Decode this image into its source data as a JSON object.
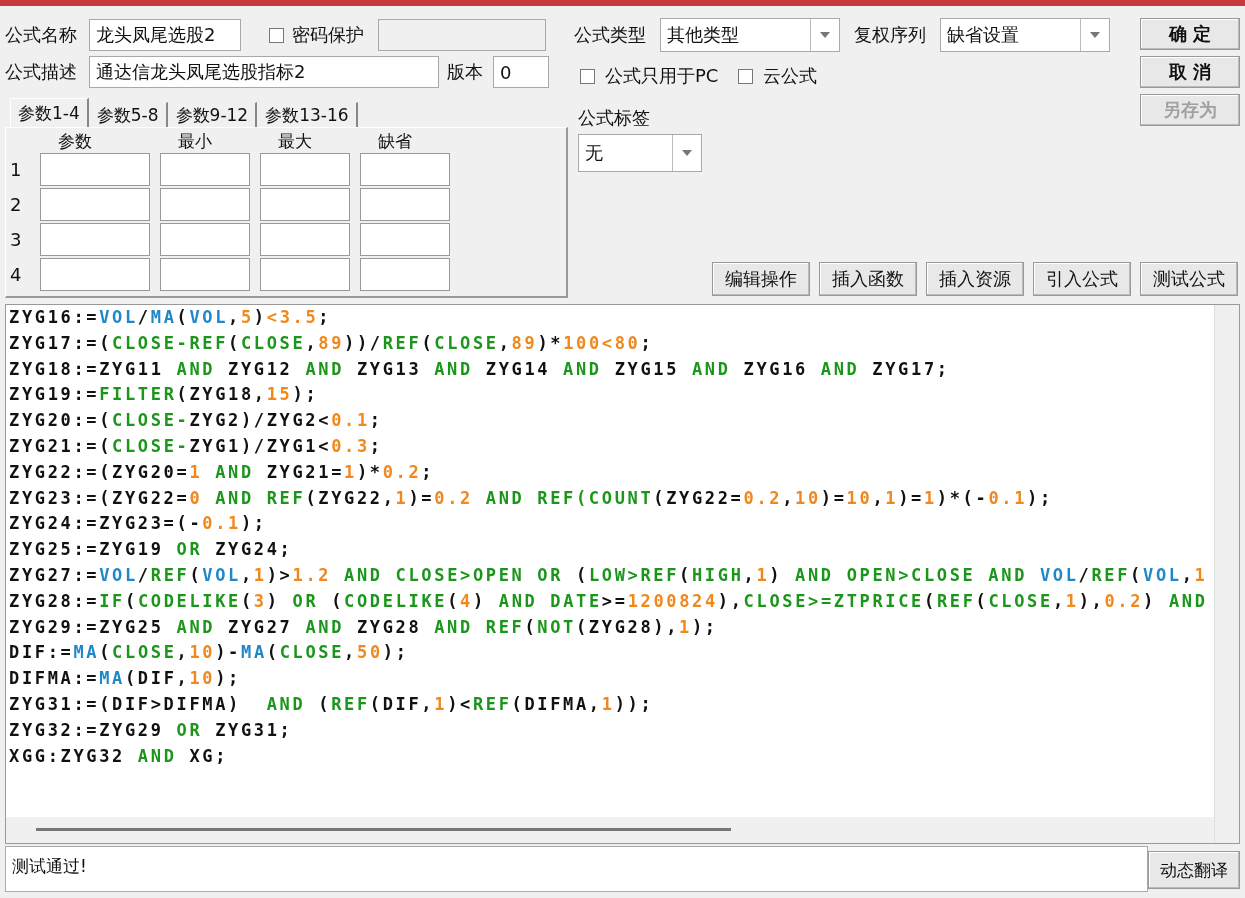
{
  "formula_name": {
    "label": "公式名称",
    "value": "龙头凤尾选股2"
  },
  "password_protect": {
    "label": "密码保护",
    "checked": false
  },
  "password_field": {
    "disabled": true
  },
  "description": {
    "label": "公式描述",
    "value": "通达信龙头凤尾选股指标2"
  },
  "version": {
    "label": "版本",
    "value": "0"
  },
  "param_tabs": [
    {
      "label": "参数1-4",
      "selected": true
    },
    {
      "label": "参数5-8",
      "selected": false
    },
    {
      "label": "参数9-12",
      "selected": false
    },
    {
      "label": "参数13-16",
      "selected": false
    }
  ],
  "param_table": {
    "columns": [
      "参数",
      "最小",
      "最大",
      "缺省"
    ],
    "rows": [
      "1",
      "2",
      "3",
      "4"
    ]
  },
  "formula_type": {
    "label": "公式类型",
    "value": "其他类型"
  },
  "rights_sequence": {
    "label": "复权序列",
    "value": "缺省设置"
  },
  "options": [
    {
      "label": "公式只用于PC",
      "checked": false
    },
    {
      "label": "云公式",
      "checked": false
    }
  ],
  "tag": {
    "label": "公式标签",
    "value": "无"
  },
  "dialog_buttons": [
    {
      "label": "确 定",
      "disabled": false
    },
    {
      "label": "取 消",
      "disabled": false
    },
    {
      "label": "另存为",
      "disabled": true
    }
  ],
  "tool_buttons": [
    "编辑操作",
    "插入函数",
    "插入资源",
    "引入公式",
    "测试公式"
  ],
  "editor": {
    "lines": [
      {
        "tokens": [
          {
            "kind": "plain",
            "text": "ZYG16:="
          },
          {
            "kind": "fn",
            "text": "VOL"
          },
          {
            "kind": "plain",
            "text": "/"
          },
          {
            "kind": "fn",
            "text": "MA"
          },
          {
            "kind": "plain",
            "text": "("
          },
          {
            "kind": "fn",
            "text": "VOL"
          },
          {
            "kind": "plain",
            "text": ","
          },
          {
            "kind": "num",
            "text": "5"
          },
          {
            "kind": "plain",
            "text": ")"
          },
          {
            "kind": "num",
            "text": "<3.5"
          },
          {
            "kind": "plain",
            "text": ";"
          }
        ]
      },
      {
        "tokens": [
          {
            "kind": "plain",
            "text": "ZYG17:=("
          },
          {
            "kind": "kw",
            "text": "CLOSE-REF"
          },
          {
            "kind": "plain",
            "text": "("
          },
          {
            "kind": "kw",
            "text": "CLOSE"
          },
          {
            "kind": "plain",
            "text": ","
          },
          {
            "kind": "num",
            "text": "89"
          },
          {
            "kind": "plain",
            "text": "))/"
          },
          {
            "kind": "kw",
            "text": "REF"
          },
          {
            "kind": "plain",
            "text": "("
          },
          {
            "kind": "kw",
            "text": "CLOSE"
          },
          {
            "kind": "plain",
            "text": ","
          },
          {
            "kind": "num",
            "text": "89"
          },
          {
            "kind": "plain",
            "text": ")*"
          },
          {
            "kind": "num",
            "text": "100<80"
          },
          {
            "kind": "plain",
            "text": ";"
          }
        ]
      },
      {
        "tokens": [
          {
            "kind": "plain",
            "text": "ZYG18:=ZYG11 "
          },
          {
            "kind": "kw",
            "text": "AND"
          },
          {
            "kind": "plain",
            "text": " ZYG12 "
          },
          {
            "kind": "kw",
            "text": "AND"
          },
          {
            "kind": "plain",
            "text": " ZYG13 "
          },
          {
            "kind": "kw",
            "text": "AND"
          },
          {
            "kind": "plain",
            "text": " ZYG14 "
          },
          {
            "kind": "kw",
            "text": "AND"
          },
          {
            "kind": "plain",
            "text": " ZYG15 "
          },
          {
            "kind": "kw",
            "text": "AND"
          },
          {
            "kind": "plain",
            "text": " ZYG16 "
          },
          {
            "kind": "kw",
            "text": "AND"
          },
          {
            "kind": "plain",
            "text": " ZYG17;"
          }
        ]
      },
      {
        "tokens": [
          {
            "kind": "plain",
            "text": "ZYG19:="
          },
          {
            "kind": "kw",
            "text": "FILTER"
          },
          {
            "kind": "plain",
            "text": "(ZYG18,"
          },
          {
            "kind": "num",
            "text": "15"
          },
          {
            "kind": "plain",
            "text": ");"
          }
        ]
      },
      {
        "tokens": [
          {
            "kind": "plain",
            "text": "ZYG20:=("
          },
          {
            "kind": "kw",
            "text": "CLOSE-"
          },
          {
            "kind": "plain",
            "text": "ZYG2)/ZYG2<"
          },
          {
            "kind": "num",
            "text": "0.1"
          },
          {
            "kind": "plain",
            "text": ";"
          }
        ]
      },
      {
        "tokens": [
          {
            "kind": "plain",
            "text": "ZYG21:=("
          },
          {
            "kind": "kw",
            "text": "CLOSE-"
          },
          {
            "kind": "plain",
            "text": "ZYG1)/ZYG1<"
          },
          {
            "kind": "num",
            "text": "0.3"
          },
          {
            "kind": "plain",
            "text": ";"
          }
        ]
      },
      {
        "tokens": [
          {
            "kind": "plain",
            "text": "ZYG22:=(ZYG20="
          },
          {
            "kind": "num",
            "text": "1"
          },
          {
            "kind": "kw",
            "text": " AND"
          },
          {
            "kind": "plain",
            "text": " ZYG21="
          },
          {
            "kind": "num",
            "text": "1"
          },
          {
            "kind": "plain",
            "text": ")*"
          },
          {
            "kind": "num",
            "text": "0.2"
          },
          {
            "kind": "plain",
            "text": ";"
          }
        ]
      },
      {
        "tokens": [
          {
            "kind": "plain",
            "text": "ZYG23:=(ZYG22="
          },
          {
            "kind": "num",
            "text": "0"
          },
          {
            "kind": "kw",
            "text": " AND REF"
          },
          {
            "kind": "plain",
            "text": "(ZYG22,"
          },
          {
            "kind": "num",
            "text": "1"
          },
          {
            "kind": "plain",
            "text": ")="
          },
          {
            "kind": "num",
            "text": "0.2"
          },
          {
            "kind": "kw",
            "text": " AND REF(COUNT"
          },
          {
            "kind": "plain",
            "text": "(ZYG22="
          },
          {
            "kind": "num",
            "text": "0.2"
          },
          {
            "kind": "plain",
            "text": ","
          },
          {
            "kind": "num",
            "text": "10"
          },
          {
            "kind": "plain",
            "text": ")="
          },
          {
            "kind": "num",
            "text": "10"
          },
          {
            "kind": "plain",
            "text": ","
          },
          {
            "kind": "num",
            "text": "1"
          },
          {
            "kind": "plain",
            "text": ")="
          },
          {
            "kind": "num",
            "text": "1"
          },
          {
            "kind": "plain",
            "text": ")*(-"
          },
          {
            "kind": "num",
            "text": "0.1"
          },
          {
            "kind": "plain",
            "text": ");"
          }
        ]
      },
      {
        "tokens": [
          {
            "kind": "plain",
            "text": "ZYG24:=ZYG23=(-"
          },
          {
            "kind": "num",
            "text": "0.1"
          },
          {
            "kind": "plain",
            "text": ");"
          }
        ]
      },
      {
        "tokens": [
          {
            "kind": "plain",
            "text": "ZYG25:=ZYG19 "
          },
          {
            "kind": "kw",
            "text": "OR"
          },
          {
            "kind": "plain",
            "text": " ZYG24;"
          }
        ]
      },
      {
        "tokens": [
          {
            "kind": "plain",
            "text": "ZYG27:="
          },
          {
            "kind": "fn",
            "text": "VOL"
          },
          {
            "kind": "plain",
            "text": "/"
          },
          {
            "kind": "kw",
            "text": "REF"
          },
          {
            "kind": "plain",
            "text": "("
          },
          {
            "kind": "fn",
            "text": "VOL"
          },
          {
            "kind": "plain",
            "text": ","
          },
          {
            "kind": "num",
            "text": "1"
          },
          {
            "kind": "plain",
            "text": ")>"
          },
          {
            "kind": "num",
            "text": "1.2"
          },
          {
            "kind": "kw",
            "text": " AND CLOSE>OPEN OR"
          },
          {
            "kind": "plain",
            "text": " ("
          },
          {
            "kind": "kw",
            "text": "LOW>REF"
          },
          {
            "kind": "plain",
            "text": "("
          },
          {
            "kind": "kw",
            "text": "HIGH"
          },
          {
            "kind": "plain",
            "text": ","
          },
          {
            "kind": "num",
            "text": "1"
          },
          {
            "kind": "plain",
            "text": ") "
          },
          {
            "kind": "kw",
            "text": "AND OPEN>CLOSE AND "
          },
          {
            "kind": "fn",
            "text": "VOL"
          },
          {
            "kind": "plain",
            "text": "/"
          },
          {
            "kind": "kw",
            "text": "REF"
          },
          {
            "kind": "plain",
            "text": "("
          },
          {
            "kind": "fn",
            "text": "VOL"
          },
          {
            "kind": "plain",
            "text": ","
          },
          {
            "kind": "num",
            "text": "1"
          }
        ]
      },
      {
        "tokens": [
          {
            "kind": "plain",
            "text": "ZYG28:="
          },
          {
            "kind": "kw",
            "text": "IF"
          },
          {
            "kind": "plain",
            "text": "("
          },
          {
            "kind": "kw",
            "text": "CODELIKE"
          },
          {
            "kind": "plain",
            "text": "("
          },
          {
            "kind": "num",
            "text": "3"
          },
          {
            "kind": "plain",
            "text": ") "
          },
          {
            "kind": "kw",
            "text": "OR"
          },
          {
            "kind": "plain",
            "text": " ("
          },
          {
            "kind": "kw",
            "text": "CODELIKE"
          },
          {
            "kind": "plain",
            "text": "("
          },
          {
            "kind": "num",
            "text": "4"
          },
          {
            "kind": "plain",
            "text": ") "
          },
          {
            "kind": "kw",
            "text": "AND DATE"
          },
          {
            "kind": "plain",
            "text": ">="
          },
          {
            "kind": "num",
            "text": "1200824"
          },
          {
            "kind": "plain",
            "text": "),"
          },
          {
            "kind": "kw",
            "text": "CLOSE>=ZTPRICE"
          },
          {
            "kind": "plain",
            "text": "("
          },
          {
            "kind": "kw",
            "text": "REF"
          },
          {
            "kind": "plain",
            "text": "("
          },
          {
            "kind": "kw",
            "text": "CLOSE"
          },
          {
            "kind": "plain",
            "text": ","
          },
          {
            "kind": "num",
            "text": "1"
          },
          {
            "kind": "plain",
            "text": "),"
          },
          {
            "kind": "num",
            "text": "0.2"
          },
          {
            "kind": "plain",
            "text": ") "
          },
          {
            "kind": "kw",
            "text": "AND"
          }
        ]
      },
      {
        "tokens": [
          {
            "kind": "plain",
            "text": "ZYG29:=ZYG25 "
          },
          {
            "kind": "kw",
            "text": "AND"
          },
          {
            "kind": "plain",
            "text": " ZYG27 "
          },
          {
            "kind": "kw",
            "text": "AND"
          },
          {
            "kind": "plain",
            "text": " ZYG28 "
          },
          {
            "kind": "kw",
            "text": "AND REF"
          },
          {
            "kind": "plain",
            "text": "("
          },
          {
            "kind": "kw",
            "text": "NOT"
          },
          {
            "kind": "plain",
            "text": "(ZYG28),"
          },
          {
            "kind": "num",
            "text": "1"
          },
          {
            "kind": "plain",
            "text": ");"
          }
        ]
      },
      {
        "tokens": [
          {
            "kind": "plain",
            "text": "DIF:="
          },
          {
            "kind": "fn",
            "text": "MA"
          },
          {
            "kind": "plain",
            "text": "("
          },
          {
            "kind": "kw",
            "text": "CLOSE"
          },
          {
            "kind": "plain",
            "text": ","
          },
          {
            "kind": "num",
            "text": "10"
          },
          {
            "kind": "plain",
            "text": ")-"
          },
          {
            "kind": "fn",
            "text": "MA"
          },
          {
            "kind": "plain",
            "text": "("
          },
          {
            "kind": "kw",
            "text": "CLOSE"
          },
          {
            "kind": "plain",
            "text": ","
          },
          {
            "kind": "num",
            "text": "50"
          },
          {
            "kind": "plain",
            "text": ");"
          }
        ]
      },
      {
        "tokens": [
          {
            "kind": "plain",
            "text": "DIFMA:="
          },
          {
            "kind": "fn",
            "text": "MA"
          },
          {
            "kind": "plain",
            "text": "(DIF,"
          },
          {
            "kind": "num",
            "text": "10"
          },
          {
            "kind": "plain",
            "text": ");"
          }
        ]
      },
      {
        "tokens": [
          {
            "kind": "plain",
            "text": "ZYG31:=(DIF>DIFMA)  "
          },
          {
            "kind": "kw",
            "text": "AND"
          },
          {
            "kind": "plain",
            "text": " ("
          },
          {
            "kind": "kw",
            "text": "REF"
          },
          {
            "kind": "plain",
            "text": "(DIF,"
          },
          {
            "kind": "num",
            "text": "1"
          },
          {
            "kind": "plain",
            "text": ")<"
          },
          {
            "kind": "kw",
            "text": "REF"
          },
          {
            "kind": "plain",
            "text": "(DIFMA,"
          },
          {
            "kind": "num",
            "text": "1"
          },
          {
            "kind": "plain",
            "text": "));"
          }
        ]
      },
      {
        "tokens": [
          {
            "kind": "plain",
            "text": "ZYG32:=ZYG29 "
          },
          {
            "kind": "kw",
            "text": "OR"
          },
          {
            "kind": "plain",
            "text": " ZYG31;"
          }
        ]
      },
      {
        "tokens": [
          {
            "kind": "plain",
            "text": "XGG:ZYG32 "
          },
          {
            "kind": "kw",
            "text": "AND"
          },
          {
            "kind": "plain",
            "text": " XG;"
          }
        ]
      }
    ]
  },
  "status": {
    "text": "测试通过!"
  },
  "translate_button": {
    "label": "动态翻译"
  }
}
